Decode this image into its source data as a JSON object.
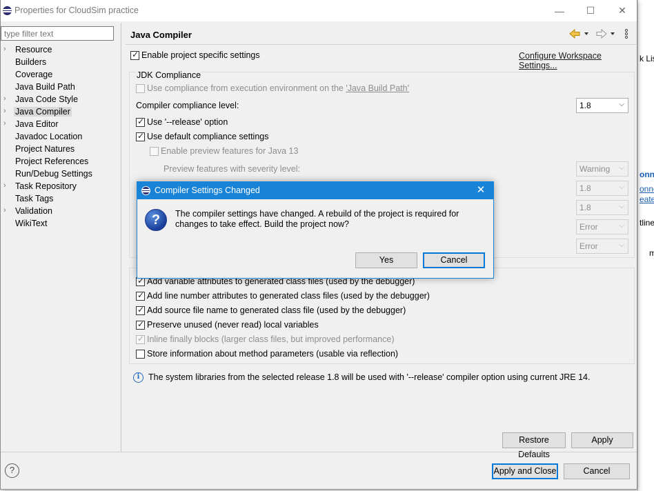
{
  "window": {
    "title": "Properties for CloudSim practice",
    "controls": {
      "minimize": "—",
      "maximize": "☐",
      "close": "✕"
    }
  },
  "filter": {
    "placeholder": "type filter text"
  },
  "tree": [
    {
      "label": "Resource",
      "expandable": true
    },
    {
      "label": "Builders",
      "expandable": false
    },
    {
      "label": "Coverage",
      "expandable": false
    },
    {
      "label": "Java Build Path",
      "expandable": false
    },
    {
      "label": "Java Code Style",
      "expandable": true
    },
    {
      "label": "Java Compiler",
      "expandable": true,
      "selected": true
    },
    {
      "label": "Java Editor",
      "expandable": true
    },
    {
      "label": "Javadoc Location",
      "expandable": false
    },
    {
      "label": "Project Natures",
      "expandable": false
    },
    {
      "label": "Project References",
      "expandable": false
    },
    {
      "label": "Run/Debug Settings",
      "expandable": false
    },
    {
      "label": "Task Repository",
      "expandable": true
    },
    {
      "label": "Task Tags",
      "expandable": false
    },
    {
      "label": "Validation",
      "expandable": true
    },
    {
      "label": "WikiText",
      "expandable": false
    }
  ],
  "page": {
    "title": "Java Compiler",
    "enable_specific": "Enable project specific settings",
    "configure_link": "Configure Workspace Settings...",
    "jdk": {
      "legend": "JDK Compliance",
      "use_env_prefix": "Use compliance from execution environment on the ",
      "use_env_link": "'Java Build Path'",
      "level_label": "Compiler compliance level:",
      "level_value": "1.8",
      "use_release": "Use '--release' option",
      "use_default": "Use default compliance settings",
      "enable_preview": "Enable preview features for Java 13",
      "preview_severity_label": "Preview features with severity level:",
      "disabled_combos": [
        "Warning",
        "1.8",
        "1.8",
        "Error",
        "Error"
      ]
    },
    "classfile": [
      {
        "label": "Add variable attributes to generated class files (used by the debugger)",
        "checked": true,
        "disabled": false
      },
      {
        "label": "Add line number attributes to generated class files (used by the debugger)",
        "checked": true,
        "disabled": false
      },
      {
        "label": "Add source file name to generated class file (used by the debugger)",
        "checked": true,
        "disabled": false
      },
      {
        "label": "Preserve unused (never read) local variables",
        "checked": true,
        "disabled": false
      },
      {
        "label": "Inline finally blocks (larger class files, but improved performance)",
        "checked": true,
        "disabled": true
      },
      {
        "label": "Store information about method parameters (usable via reflection)",
        "checked": false,
        "disabled": false
      }
    ],
    "info": "The system libraries from the selected release 1.8 will be used with '--release' compiler option using current JRE 14.",
    "restore_defaults": "Restore Defaults",
    "apply": "Apply"
  },
  "footer": {
    "help": "?",
    "apply_close": "Apply and Close",
    "cancel": "Cancel"
  },
  "dialog": {
    "title": "Compiler Settings Changed",
    "close": "✕",
    "icon": "?",
    "message": "The compiler settings have changed. A rebuild of the project is required for changes to take effect. Build the project now?",
    "yes": "Yes",
    "cancel": "Cancel"
  },
  "background": {
    "frags": [
      "k Lis",
      "onne",
      "onne",
      "eate",
      "tline",
      "m"
    ]
  }
}
